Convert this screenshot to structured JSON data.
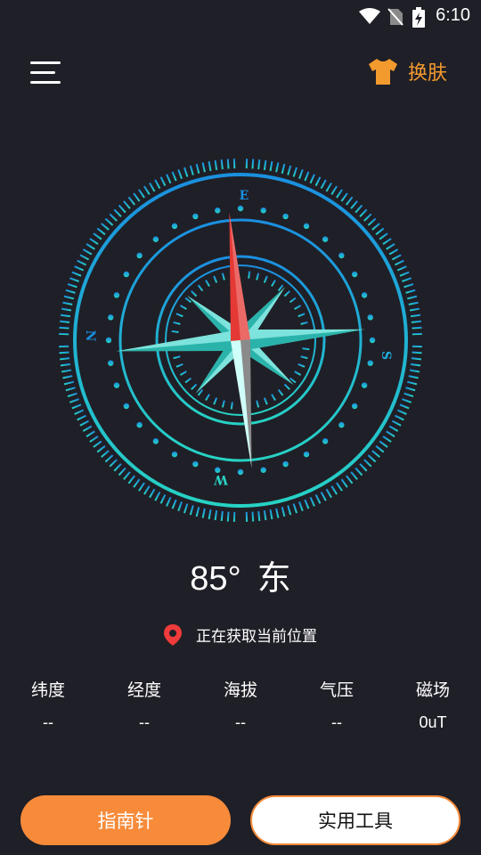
{
  "status_bar": {
    "time": "6:10"
  },
  "header": {
    "skin_label": "换肤"
  },
  "compass": {
    "heading_value": "85°",
    "heading_direction": "东",
    "cardinals": {
      "north": "N",
      "east": "E",
      "south": "S",
      "west": "W"
    }
  },
  "location": {
    "status": "正在获取当前位置"
  },
  "stats": [
    {
      "label": "纬度",
      "value": "--"
    },
    {
      "label": "经度",
      "value": "--"
    },
    {
      "label": "海拔",
      "value": "--"
    },
    {
      "label": "气压",
      "value": "--"
    },
    {
      "label": "磁场",
      "value": "0uT"
    }
  ],
  "bottom_nav": {
    "compass_label": "指南针",
    "tools_label": "实用工具"
  },
  "colors": {
    "accent": "#f78b3a",
    "skin": "#f39a2e",
    "ring_blue": "#1a8fe0",
    "ring_teal": "#27d3c4",
    "needle_red": "#e53935"
  }
}
